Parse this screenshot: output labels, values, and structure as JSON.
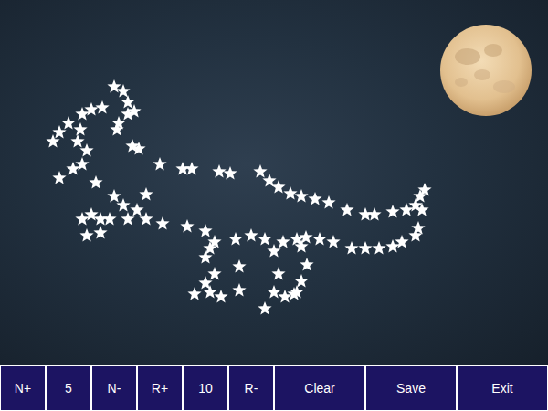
{
  "toolbar": {
    "items": [
      {
        "label": "N+",
        "kind": "button"
      },
      {
        "label": "5",
        "kind": "value"
      },
      {
        "label": "N-",
        "kind": "button"
      },
      {
        "label": "R+",
        "kind": "button"
      },
      {
        "label": "10",
        "kind": "value"
      },
      {
        "label": "R-",
        "kind": "button"
      },
      {
        "label": "Clear",
        "kind": "wide"
      },
      {
        "label": "Save",
        "kind": "wide"
      },
      {
        "label": "Exit",
        "kind": "wide"
      }
    ]
  }
}
